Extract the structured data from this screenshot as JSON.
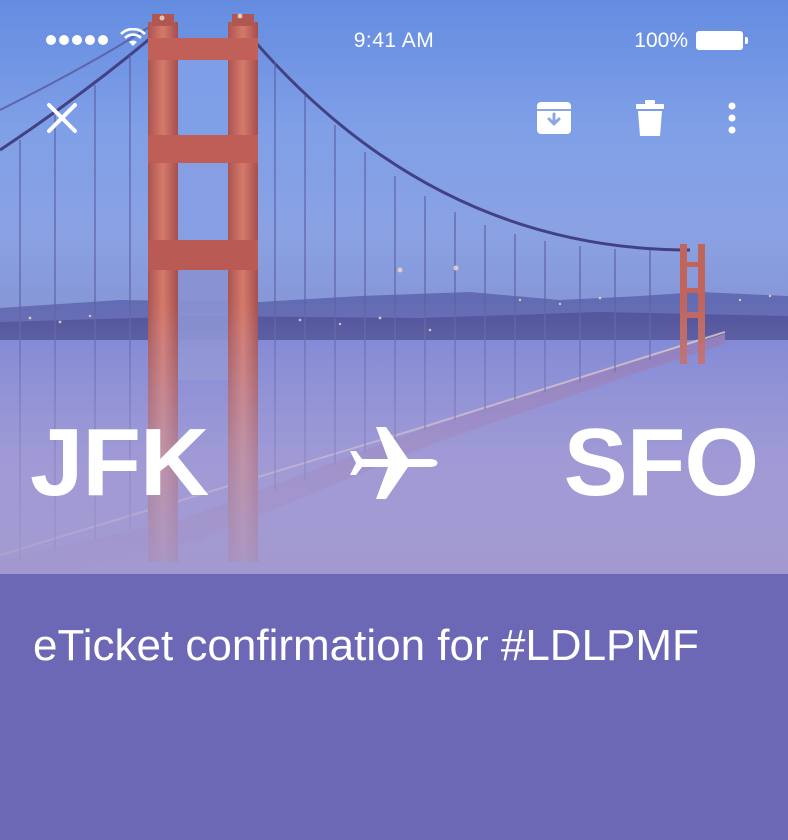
{
  "status_bar": {
    "time": "9:41 AM",
    "battery_percent": "100%",
    "signal_icon": "signal-dots-icon",
    "wifi_icon": "wifi-icon",
    "battery_icon": "battery-icon"
  },
  "toolbar": {
    "close_icon": "close-icon",
    "archive_icon": "archive-icon",
    "delete_icon": "trash-icon",
    "more_icon": "more-vertical-icon"
  },
  "route": {
    "origin": "JFK",
    "destination": "SFO",
    "plane_icon": "airplane-icon"
  },
  "message": {
    "subject": "eTicket confirmation for #LDLPMF"
  },
  "colors": {
    "panel": "#6c68b6",
    "text": "#ffffff"
  }
}
